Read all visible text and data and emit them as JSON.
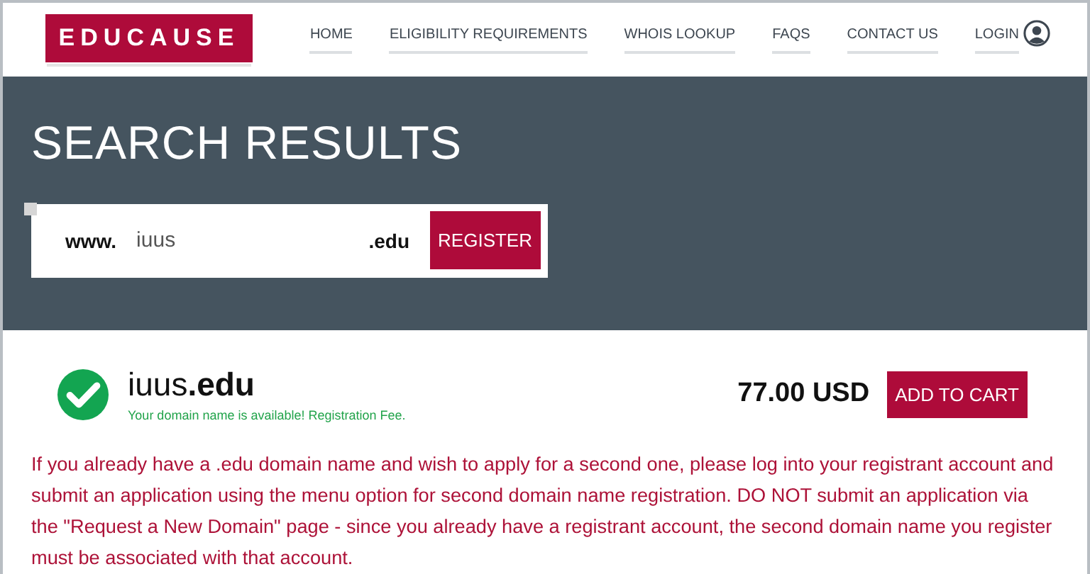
{
  "logo": "EDUCAUSE",
  "nav": [
    {
      "label": "HOME"
    },
    {
      "label": "ELIGIBILITY REQUIREMENTS"
    },
    {
      "label": "WHOIS LOOKUP"
    },
    {
      "label": "FAQS"
    },
    {
      "label": "CONTACT US"
    },
    {
      "label": "LOGIN"
    }
  ],
  "hero": {
    "title": "SEARCH RESULTS"
  },
  "search": {
    "prefix": "www.",
    "value": "iuus",
    "suffix": ".edu",
    "button": "REGISTER"
  },
  "result": {
    "domain": "iuus**.edu**",
    "message": "Your domain name is available! Registration Fee.",
    "price": "77.00 USD",
    "button": "ADD TO CART"
  },
  "notice": "If you already have a .edu domain name and wish to apply for a second one, please log into your registrant account and submit an application using the menu option for second domain name registration. DO NOT submit an application via the \"Request a New Domain\" page - since you already have a registrant account, the second domain name you register must be associated with that account."
}
